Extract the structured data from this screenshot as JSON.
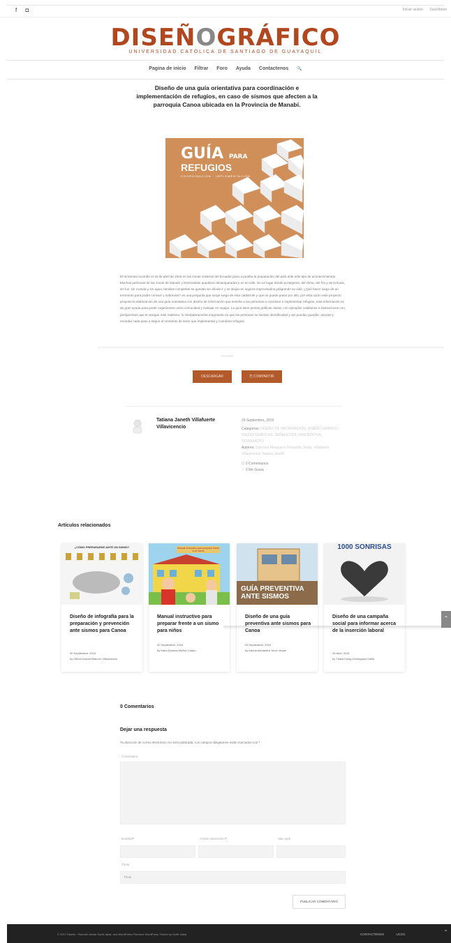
{
  "topbar": {
    "social": [
      "f",
      "◘"
    ],
    "links": [
      "Iniciar sesión",
      "Suscribirse"
    ]
  },
  "logo": {
    "part1": "DISEÑ",
    "part2": "O",
    "part3": "GRÁFICO",
    "subtitle": "UNIVERSIDAD CATÓLICA DE SANTIAGO DE GUAYAQUIL"
  },
  "nav": {
    "items": [
      "Pagina de inicio",
      "Filtrar",
      "Foro",
      "Ayuda",
      "Contactenos"
    ],
    "search_icon": "🔍"
  },
  "post": {
    "title": "Diseño de una guía orientativa para coordinación e implementación de refugios, en caso de sismos que afecten a la parroquia Canoa ubicada en la Provincia de Manabí.",
    "cover": {
      "title_big": "GUÍA",
      "title_small": "PARA",
      "title_line2": "REFUGIOS",
      "title_line3": "COORDINACIÓN · IMPLEMENTACIÓN"
    },
    "description": "El terremoto ocurrido el 16 de abril de 2016 en las zonas costeras del Ecuador puso a prueba la preparación del país ante este tipo de acontecimientos. Muchas personas de las zonas de Manabí y Esmeraldas quedaron desamparadas y en la calle, sin un lugar donde protegerse, del clima, del frío y de la lluvia, sin luz, sin comida y sin agua; familias completas se quedan sin dónde ir y se alojan en lugares improvisados peligrando su vida. ¿Qué hacer luego de un terremoto para poder convivir y sobrevivir? es una pregunta que surge luego de esta catástrofe y que no puede pasar por alto, por esta razón este proyecto propone la elaboración de una guía orientativa con diseño de información que enseñe a las personas a coordinar e implementar refugios, esta información es de gran ayuda para poder organizarse como comunidad y trabajar en equipo. La guía tiene piezas gráficas claras, con ejemplos cotidianos e ilustraciones con perspectivas que le otorgan más realismo, lo verdaderamente importante es que las personas se sientan identificadas y así puedan guardar, asociar y recordar cada paso a seguir al momento de tener que implementar y coordinar refugios.",
    "buttons": {
      "download": "DESCARGAR",
      "share": "⎘ COMPARTIR"
    },
    "author": {
      "name": "Tatiana Janeth Villafuerte Villavicencio",
      "date": "29 Septiembre, 2016",
      "categories_label": "Categorías:",
      "categories": "DISEÑO DE INFORMACIÓN, DISEÑO GRÁFICO, PIEZAS GRÁFICAS, SEÑALÉTICA, ORIENTATIVA, TERREMOTO",
      "authors_label": "Autores:",
      "authors": "Sánchez Mosquera Fernando Jesús, Villafuerte Villavicencio Tatiana Janeth",
      "comments": "0 Comentarios",
      "likes": "0 Me Gusta"
    }
  },
  "related": {
    "heading": "Artículos relacionados",
    "cards": [
      {
        "title": "Diseño de infografía para la preparación y prevención ante sismos para Canoa",
        "date": "30 Septiembre, 2016",
        "by": "by Gilbert Armani Marcon Villavicencio",
        "img_text": "¿CÓMO PREPARARSE ANTE UN SISMO?"
      },
      {
        "title": "Manual instructivo para preparar frente a un sismo para niños",
        "date": "30 Septiembre, 2016",
        "by": "by Karla Dolores Muñoz Castro",
        "img_text": "Manual instructivo para preparar frente a un sismo"
      },
      {
        "title": "Diseño de una guía preventiva ante sismos para Canoa",
        "date": "29 Septiembre, 2016",
        "by": "by Karina Alexandra Tinoé Veque",
        "img_text": "GUÍA PREVENTIVA ANTE SISMOS"
      },
      {
        "title": "Diseño de una campaña social para informar acerca de la inserción laboral",
        "date": "28 Abril, 2016",
        "by": "by Thalia Dolay Domínguez Dalila",
        "img_text": "1000 SONRISAS"
      }
    ]
  },
  "comments": {
    "count_heading": "0 Comentarios",
    "reply_heading": "Dejar una respuesta",
    "note": "Tu dirección de correo electrónico no será publicada. Los campos obligatorios están marcados con",
    "req_mark": "*",
    "fields": {
      "comment": "Comentario",
      "name": "Nombre",
      "email": "Correo electrónico",
      "web": "Sitio web",
      "title_label": "Título",
      "title_placeholder": "Título"
    },
    "submit": "PUBLICAR COMENTARIO"
  },
  "footer": {
    "text": "© 2017 Diseño · Borrarlo desde Surfit Jakar, una WordPress Premium WordPress Theme by Surfit Jakar",
    "links": [
      "CONTACTENOS",
      "UCSG"
    ],
    "up_icon": "⌃"
  },
  "colors": {
    "brand": "#b1471f",
    "accent_button": "#b35a2c",
    "cover": "#d08e58",
    "footer": "#222222"
  }
}
